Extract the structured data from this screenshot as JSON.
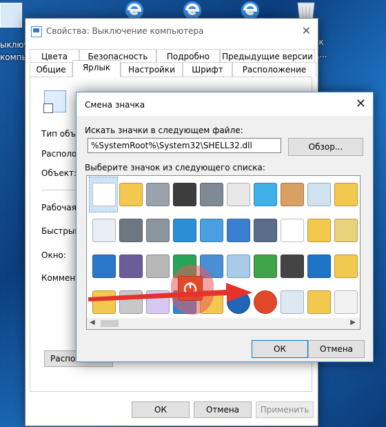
{
  "desktop": {
    "left_label_1": "ыключ",
    "left_label_2": "компь",
    "right_label_1": "ок",
    "right_label_2": "ц..."
  },
  "properties_window": {
    "title": "Свойства: Выключение компьютера",
    "tabs_row1": [
      "Цвета",
      "Безопасность",
      "Подробно",
      "Предыдущие версии"
    ],
    "tabs_row2": [
      "Общие",
      "Ярлык",
      "Настройки",
      "Шрифт",
      "Расположение"
    ],
    "active_tab": "Ярлык",
    "fields": [
      "Тип объе",
      "Располо",
      "Объект:",
      "Рабочая",
      "Быстрый",
      "Окно:",
      "Коммент"
    ],
    "placement_button": "Располо",
    "ok_button": "ОК",
    "cancel_button": "Отмена",
    "apply_button": "Применить"
  },
  "change_icon_dialog": {
    "title": "Смена значка",
    "search_label": "Искать значки в следующем файле:",
    "path_value": "%SystemRoot%\\System32\\SHELL32.dll",
    "browse_button": "Обзор...",
    "list_label": "Выберите значок из следующего списка:",
    "ok_button": "ОК",
    "cancel_button": "Отмена",
    "icons": [
      [
        "blank-document",
        "folder",
        "drive",
        "chip",
        "printer",
        "clock-document",
        "monitor-window",
        "hand",
        "recycle-bin-full",
        "folder-doc"
      ],
      [
        "text-document",
        "network-printer",
        "network-drive",
        "globe",
        "network-monitor",
        "control-panel",
        "floppy-shortcut",
        "shortcut-arrow",
        "folder-shared",
        "printer-folder"
      ],
      [
        "window",
        "floppy",
        "network-disconnect",
        "globe-mouse",
        "network",
        "magnifier",
        "run-arrow",
        "speaker-shortcut",
        "monitor-blue",
        "folder-a"
      ],
      [
        "folder-small",
        "drive-removable",
        "cd-rom",
        "hdd-blue",
        "folder-grid",
        "power-blue",
        "power-red",
        "recycle-bin",
        "folder-tools",
        "document-lines"
      ]
    ],
    "selected_icon": "blank-document"
  },
  "colors": {
    "accent": "#0078d7",
    "arrow": "#e5322d",
    "highlight": "#e95a5a",
    "power_icon": "#e2482a"
  }
}
